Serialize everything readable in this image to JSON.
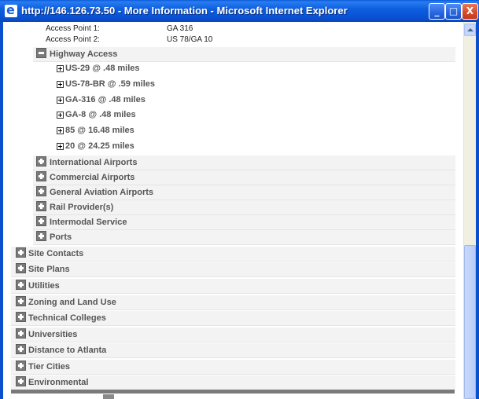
{
  "window": {
    "title": "http://146.126.73.50 - More Information - Microsoft Internet Explorer",
    "minimize": "_",
    "maximize": "□",
    "close": "X"
  },
  "access_points": [
    {
      "label": "Access Point 1:",
      "value": "GA 316"
    },
    {
      "label": "Access Point 2:",
      "value": "US 78/GA 10"
    }
  ],
  "highway_access": {
    "label": "Highway Access",
    "items": [
      "US-29 @ .48 miles",
      "US-78-BR @ .59 miles",
      "GA-316 @ .48 miles",
      "GA-8 @ .48 miles",
      "85 @ 16.48 miles",
      "20 @ 24.25 miles"
    ]
  },
  "transport_sections": [
    "International Airports",
    "Commercial Airports",
    "General Aviation Airports",
    "Rail Provider(s)",
    "Intermodal Service",
    "Ports"
  ],
  "top_sections": [
    "Site Contacts",
    "Site Plans",
    "Utilities",
    "Zoning and Land Use",
    "Technical Colleges",
    "Universities",
    "Distance to Atlanta",
    "Tier Cities",
    "Environmental"
  ]
}
